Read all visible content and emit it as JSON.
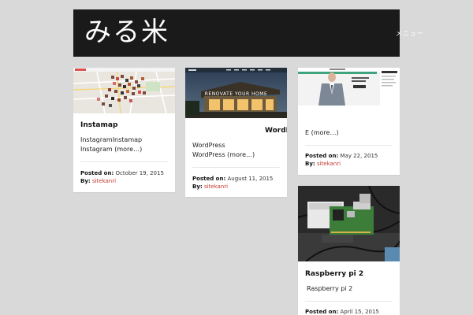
{
  "header": {
    "site_title": "みる米",
    "menu_label": "メニュー"
  },
  "labels": {
    "posted_on": "Posted on:",
    "by": "By:"
  },
  "posts": [
    {
      "title": "Instamap",
      "excerpt_line1": "InstagramInstamap",
      "excerpt_line2": "Instagram",
      "more": "(more…)",
      "date": "October 19, 2015",
      "author": "sitekanri"
    },
    {
      "title": "WordPr",
      "thumb_caption": "RENOVATE YOUR HOME",
      "excerpt_line1": "WordPress",
      "excerpt_line2": "WordPress",
      "more": "(more…)",
      "date": "August 11, 2015",
      "author": "sitekanri"
    },
    {
      "title": "",
      "excerpt_line1": "E",
      "more": "(more…)",
      "date": "May 22, 2015",
      "author": "sitekanri"
    },
    {
      "title": "Raspberry pi 2",
      "excerpt_line1": "Raspberry pi 2",
      "date": "April 15, 2015"
    }
  ],
  "colors": {
    "page_bg": "#d9d9d9",
    "header_bg": "#1a1a1a",
    "author_link": "#c0392b"
  }
}
